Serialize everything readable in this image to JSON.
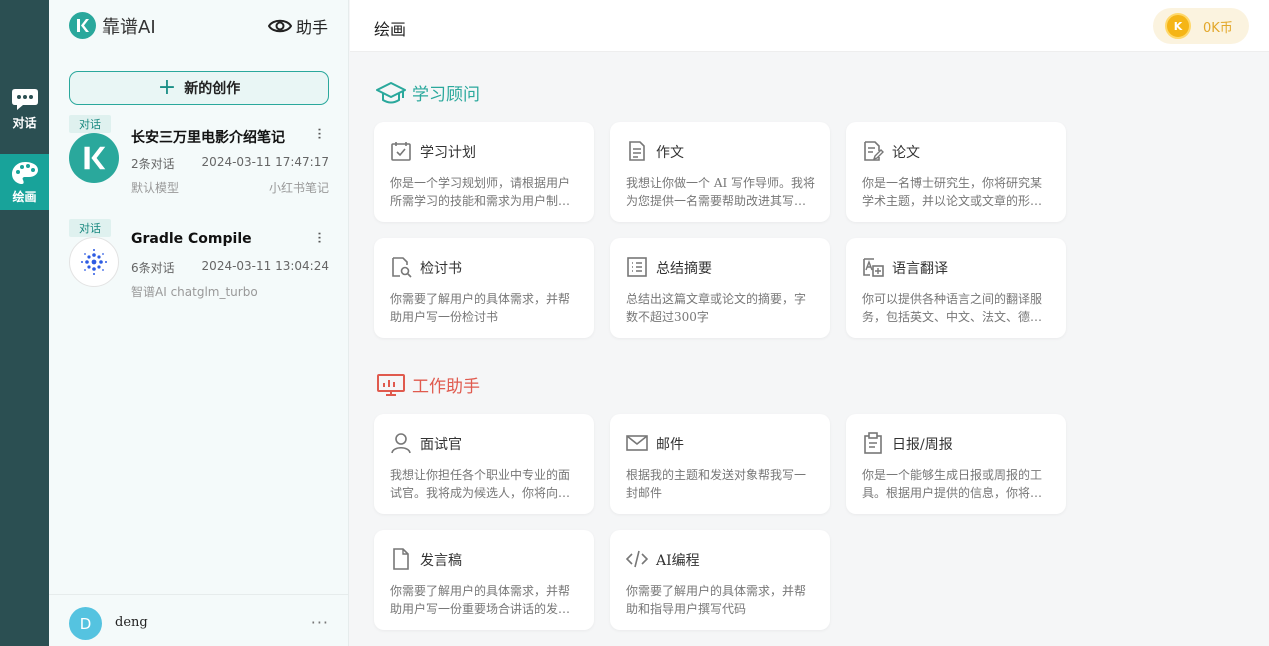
{
  "rail": {
    "items": [
      {
        "label": "对话",
        "icon": "chat-bubble-icon"
      },
      {
        "label": "绘画",
        "icon": "palette-icon",
        "active": true
      }
    ]
  },
  "sidebar": {
    "logo_text": "靠谱AI",
    "assistant_label": "助手",
    "new_button_label": "新的创作",
    "conversations": [
      {
        "tag": "对话",
        "title": "长安三万里电影介绍笔记",
        "count": "2条对话",
        "time": "2024-03-11 17:47:17",
        "model": "默认模型",
        "source": "小红书笔记"
      },
      {
        "tag": "对话",
        "title": "Gradle Compile",
        "count": "6条对话",
        "time": "2024-03-11 13:04:24",
        "model": "智谱AI chatglm_turbo",
        "source": ""
      }
    ],
    "user": {
      "initial": "D",
      "name": "deng",
      "more": "···"
    }
  },
  "header": {
    "title": "绘画",
    "coin_symbol": "K",
    "coin_label": "0K币"
  },
  "sections": [
    {
      "title": "学习顾问",
      "color": "#2aa89c",
      "cards": [
        {
          "title": "学习计划",
          "desc": "你是一个学习规划师，请根据用户所需学习的技能和需求为用户制定学习计划",
          "icon": "calendar-check-icon"
        },
        {
          "title": "作文",
          "desc": "我想让你做一个 AI 写作导师。我将为您提供一名需要帮助改进其写作的学生",
          "icon": "document-icon"
        },
        {
          "title": "论文",
          "desc": "你是一名博士研究生，你将研究某学术主题，并以论文或文章的形式呈现",
          "icon": "document-edit-icon"
        },
        {
          "title": "检讨书",
          "desc": "你需要了解用户的具体需求，并帮助用户写一份检讨书",
          "icon": "document-search-icon"
        },
        {
          "title": "总结摘要",
          "desc": "总结出这篇文章或论文的摘要，字数不超过300字",
          "icon": "list-icon"
        },
        {
          "title": "语言翻译",
          "desc": "你可以提供各种语言之间的翻译服务，包括英文、中文、法文、德文等",
          "icon": "translate-icon"
        }
      ]
    },
    {
      "title": "工作助手",
      "color": "#e05a4e",
      "cards": [
        {
          "title": "面试官",
          "desc": "我想让你担任各个职业中专业的面试官。我将成为候选人，你将向我提问",
          "icon": "person-icon"
        },
        {
          "title": "邮件",
          "desc": "根据我的主题和发送对象帮我写一封邮件",
          "icon": "mail-icon"
        },
        {
          "title": "日报/周报",
          "desc": "你是一个能够生成日报或周报的工具。根据用户提供的信息，你将生成报告",
          "icon": "clipboard-icon"
        },
        {
          "title": "发言稿",
          "desc": "你需要了解用户的具体需求，并帮助用户写一份重要场合讲话的发言稿",
          "icon": "file-icon"
        },
        {
          "title": "AI编程",
          "desc": "你需要了解用户的具体需求，并帮助和指导用户撰写代码",
          "icon": "code-icon"
        }
      ]
    }
  ]
}
